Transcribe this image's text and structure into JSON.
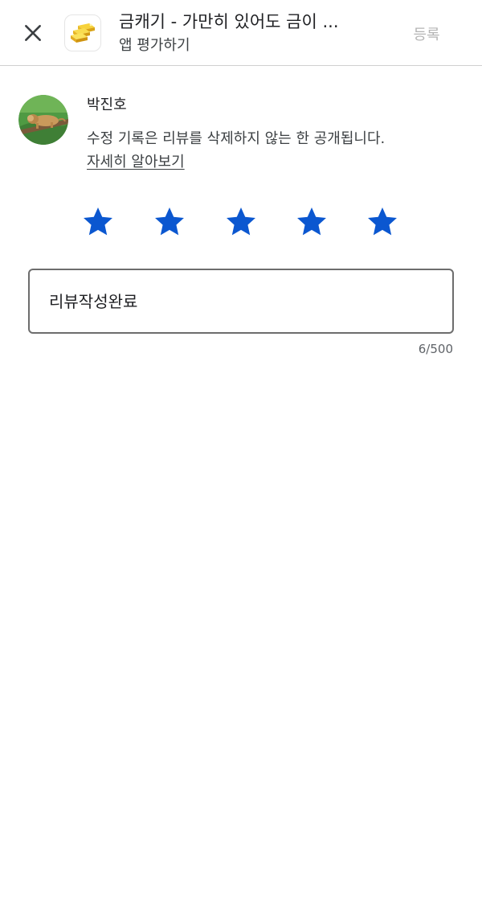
{
  "header": {
    "app_title": "금캐기 - 가만히 있어도 금이 ...",
    "subtitle": "앱 평가하기",
    "submit_label": "등록",
    "close_icon": "close-icon",
    "app_icon": "gold-bars-icon"
  },
  "user": {
    "name": "박진호",
    "notice": "수정 기록은 리뷰를 삭제하지 않는 한 공개됩니다.",
    "learn_more": "자세히 알아보기"
  },
  "rating": {
    "value": 5,
    "max": 5,
    "color": "#0b57d0"
  },
  "review": {
    "text": "리뷰작성완료",
    "char_count": "6/500"
  },
  "colors": {
    "star": "#0b57d0",
    "submit_disabled": "#b4b4b4",
    "border": "#6d6d6d"
  }
}
